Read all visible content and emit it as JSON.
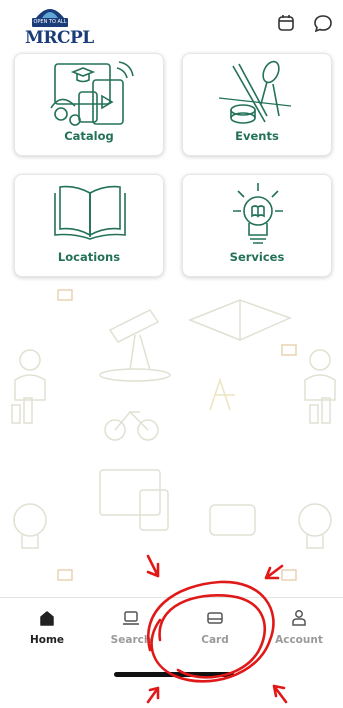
{
  "header": {
    "logo_tagline": "OPEN TO ALL",
    "logo_text": "MRCPL",
    "icons": [
      "calendar-icon",
      "chat-bubble-icon"
    ]
  },
  "tiles": [
    {
      "label": "Catalog",
      "icon": "catalog-devices-icon"
    },
    {
      "label": "Events",
      "icon": "events-scissors-icon"
    },
    {
      "label": "Locations",
      "icon": "open-book-icon"
    },
    {
      "label": "Services",
      "icon": "lightbulb-book-icon"
    }
  ],
  "nav": {
    "items": [
      {
        "label": "Home",
        "icon": "home-icon",
        "active": true
      },
      {
        "label": "Search",
        "icon": "laptop-icon",
        "active": false
      },
      {
        "label": "Card",
        "icon": "card-icon",
        "active": false
      },
      {
        "label": "Account",
        "icon": "person-icon",
        "active": false
      }
    ]
  },
  "colors": {
    "brand_blue": "#1a3d7a",
    "accent_green": "#24715a",
    "annotation_red": "#e01818"
  }
}
